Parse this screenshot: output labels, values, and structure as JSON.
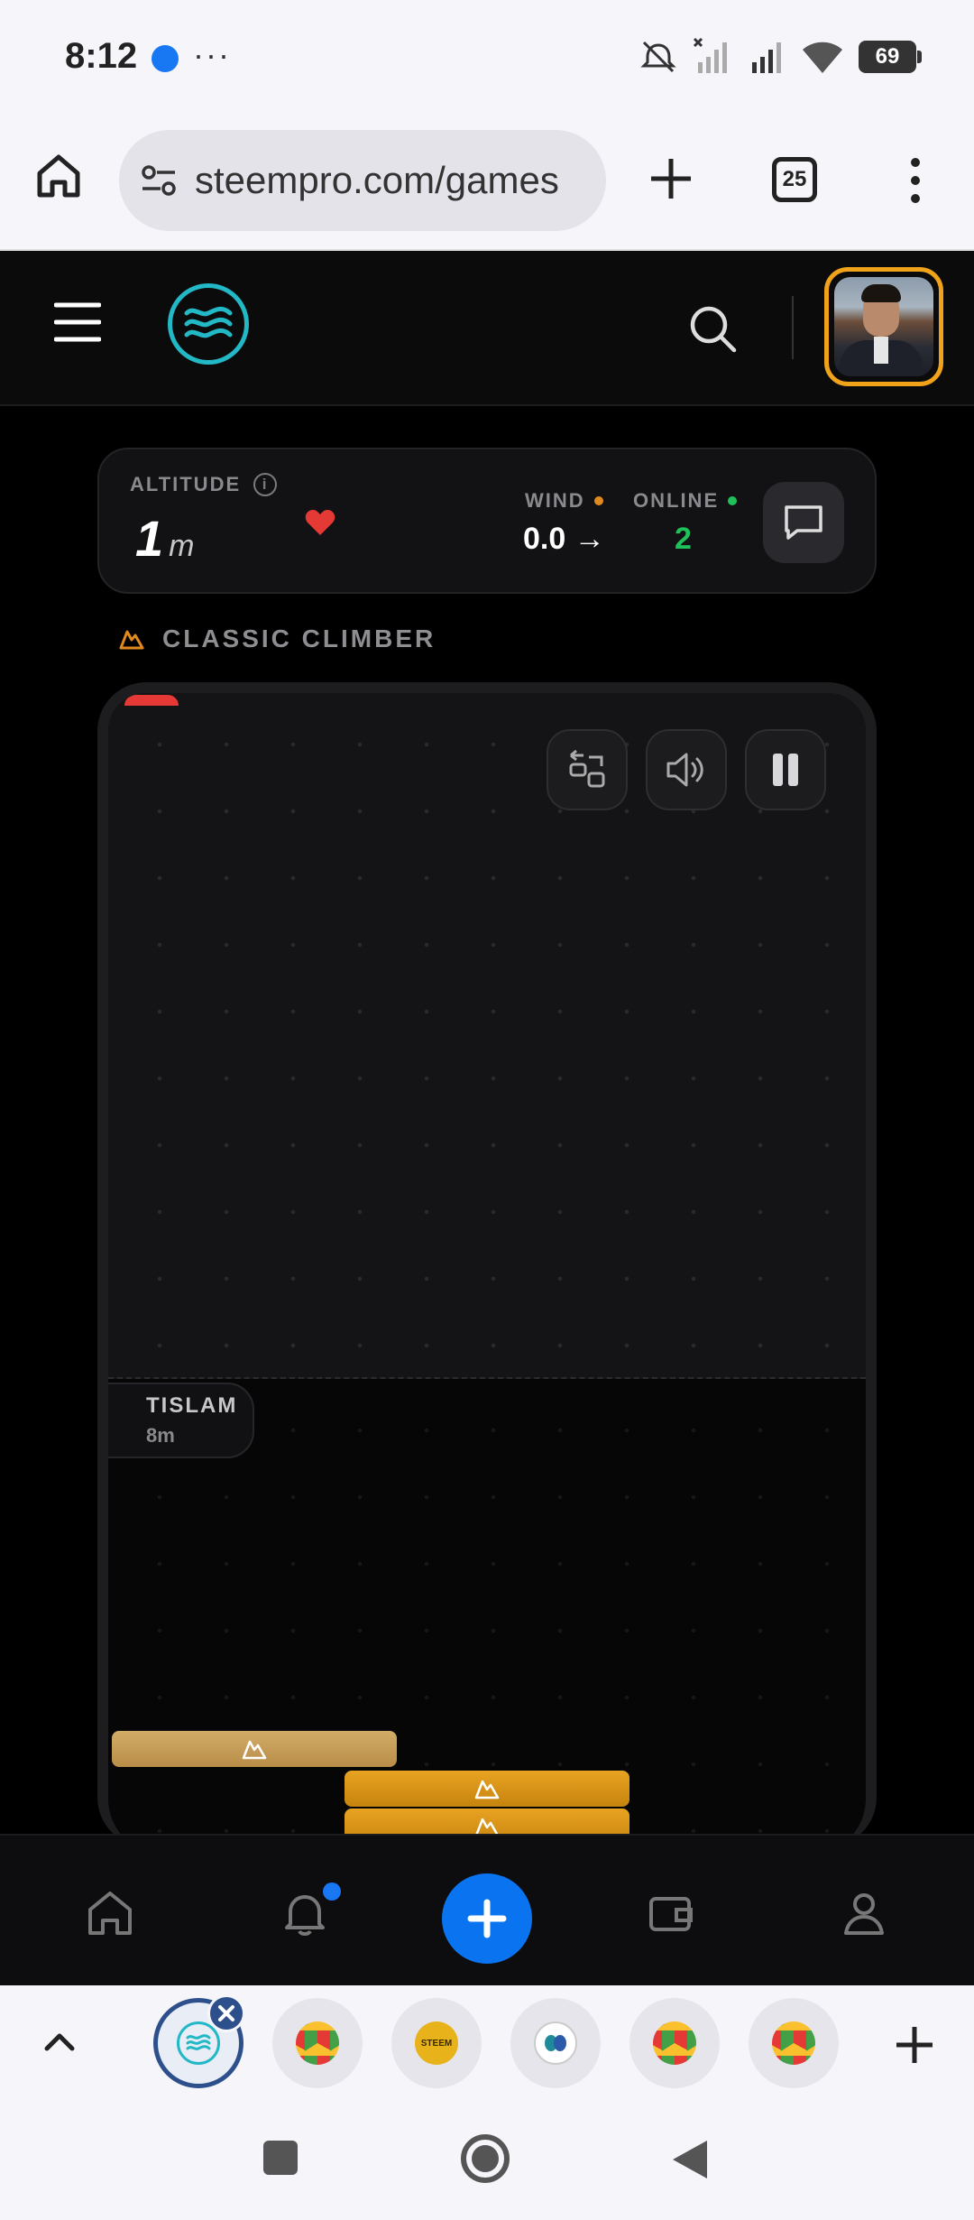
{
  "status_bar": {
    "time": "8:12",
    "more": "···",
    "battery": "69"
  },
  "browser": {
    "url": "steempro.com/games",
    "tab_count": "25"
  },
  "stats": {
    "altitude_label": "ALTITUDE",
    "altitude_value": "1",
    "altitude_unit": "m",
    "wind_label": "WIND",
    "wind_value": "0.0 →",
    "online_label": "ONLINE",
    "online_value": "2"
  },
  "game": {
    "mode_title": "CLASSIC CLIMBER",
    "player_tag": {
      "name": "TISLAM",
      "height": "8m"
    }
  },
  "colors": {
    "accent_blue": "#0a74f0",
    "avatar_border": "#f0a21a",
    "online_green": "#1fbf5a",
    "wind_dot": "#e08a1e",
    "block_gold": "#e8a322",
    "block_pale": "#d2ad68"
  },
  "icons": {
    "header": [
      "menu-icon",
      "steem-logo-icon",
      "search-icon"
    ],
    "game_controls": [
      "swap-icon",
      "volume-icon",
      "pause-icon"
    ],
    "bottom_nav": [
      "home-icon",
      "bell-icon",
      "plus-icon",
      "wallet-icon",
      "user-icon"
    ]
  }
}
